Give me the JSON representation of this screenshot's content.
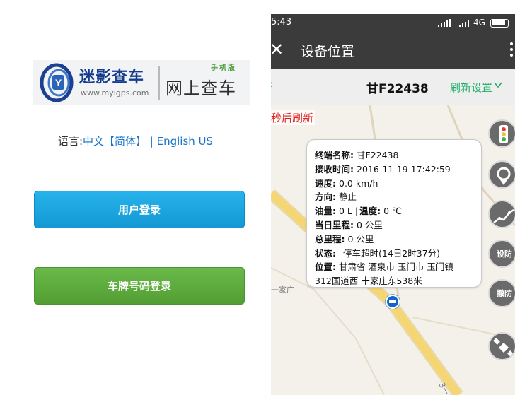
{
  "left": {
    "logo": {
      "brand_cn": "迷影查车",
      "url": "www.myigps.com",
      "mobile_tag": "手机版",
      "online_cn": "网上查车"
    },
    "language": {
      "prefix": "语言:",
      "chinese": "中文【简体】",
      "separator": " | ",
      "english": "English US"
    },
    "buttons": {
      "user_login": "用户登录",
      "plate_login": "车牌号码登录"
    },
    "colors": {
      "user_button": "#1ba5df",
      "plate_button": "#5ea93d",
      "link": "#1673c9"
    }
  },
  "right": {
    "status_bar": {
      "time": "5:43",
      "network": "4G"
    },
    "app_bar": {
      "title": "设备位置"
    },
    "header": {
      "plate": "甘F22438",
      "refresh_settings": "刷新设置"
    },
    "countdown_text": "秒后刷新",
    "map_labels": {
      "village": "一家庄",
      "road": "3一"
    },
    "info_window": {
      "terminal_label": "终端名称:",
      "terminal_value": "甘F22438",
      "time_label": "接收时间:",
      "time_value": "2016-11-19 17:42:59",
      "speed_label": "速度:",
      "speed_value": "0.0 km/h",
      "direction_label": "方向:",
      "direction_value": "静止",
      "fuel_label": "油量:",
      "fuel_value": "0 L |",
      "temp_label": "温度:",
      "temp_value": "0 ℃",
      "day_mileage_label": "当日里程:",
      "day_mileage_value": "0 公里",
      "total_mileage_label": "总里程:",
      "total_mileage_value": "0 公里",
      "status_label": "状态:",
      "status_value": "停车超时(14日2时37分)",
      "location_label": "位置:",
      "location_line1": "甘肃省 酒泉市 玉门市 玉门镇",
      "location_line2": "312国道西 十家庄东538米"
    },
    "tools": {
      "fence_text": "设防",
      "cancel_text": "撤防"
    },
    "colors": {
      "accent_green": "#1fae68",
      "countdown_red": "#e02020",
      "road_yellow": "#f2c94c",
      "bar_dark": "#3b3b3b"
    }
  }
}
